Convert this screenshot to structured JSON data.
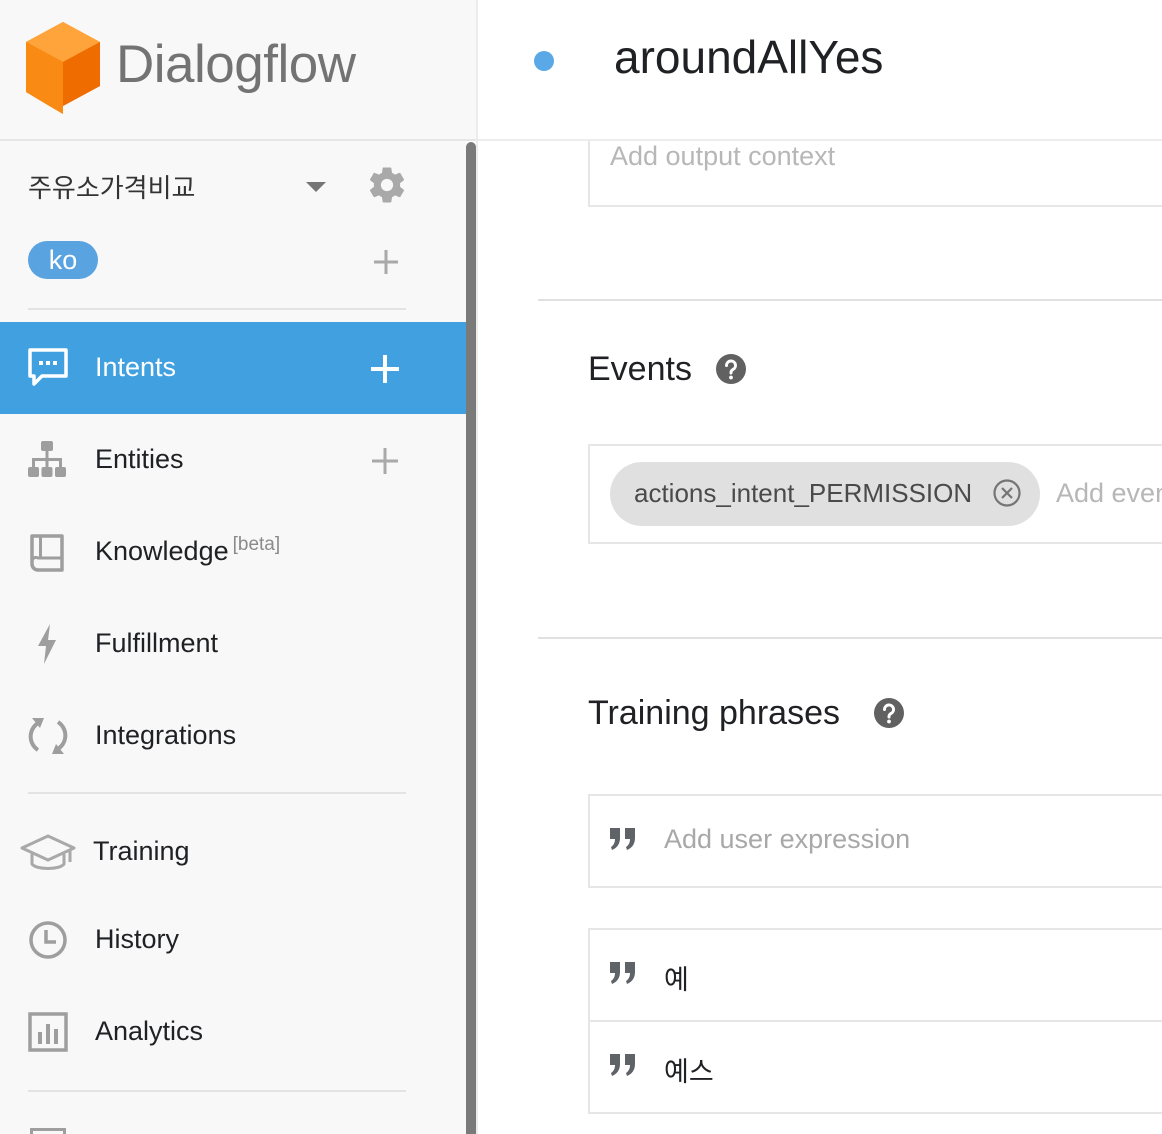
{
  "app": {
    "brand": "Dialogflow",
    "brand_colors": {
      "logo_orange": "#f57c00",
      "logo_orange_light": "#ff9a2e",
      "accent_blue": "#41a1e0"
    }
  },
  "sidebar": {
    "agent": {
      "name": "주유소가격비교",
      "dropdown_icon": "caret-down-icon",
      "settings_icon": "gear-icon"
    },
    "language": {
      "code": "ko",
      "add_icon": "plus-icon"
    },
    "nav": [
      {
        "label": "Intents",
        "icon": "chat-icon",
        "active": true,
        "has_add": true
      },
      {
        "label": "Entities",
        "icon": "hierarchy-icon",
        "active": false,
        "has_add": true
      },
      {
        "label": "Knowledge",
        "badge": "[beta]",
        "icon": "book-icon",
        "active": false
      },
      {
        "label": "Fulfillment",
        "icon": "bolt-icon",
        "active": false
      },
      {
        "label": "Integrations",
        "icon": "sync-icon",
        "active": false
      },
      {
        "label": "Training",
        "icon": "graduation-cap-icon",
        "active": false
      },
      {
        "label": "History",
        "icon": "clock-icon",
        "active": false
      },
      {
        "label": "Analytics",
        "icon": "bar-chart-icon",
        "active": false
      }
    ]
  },
  "main": {
    "intent_name": "aroundAllYes",
    "output_context": {
      "placeholder": "Add output context"
    },
    "events": {
      "title": "Events",
      "chips": [
        "actions_intent_PERMISSION"
      ],
      "placeholder": "Add event"
    },
    "training": {
      "title": "Training phrases",
      "placeholder": "Add user expression",
      "phrases": [
        "예",
        "예스"
      ]
    }
  }
}
